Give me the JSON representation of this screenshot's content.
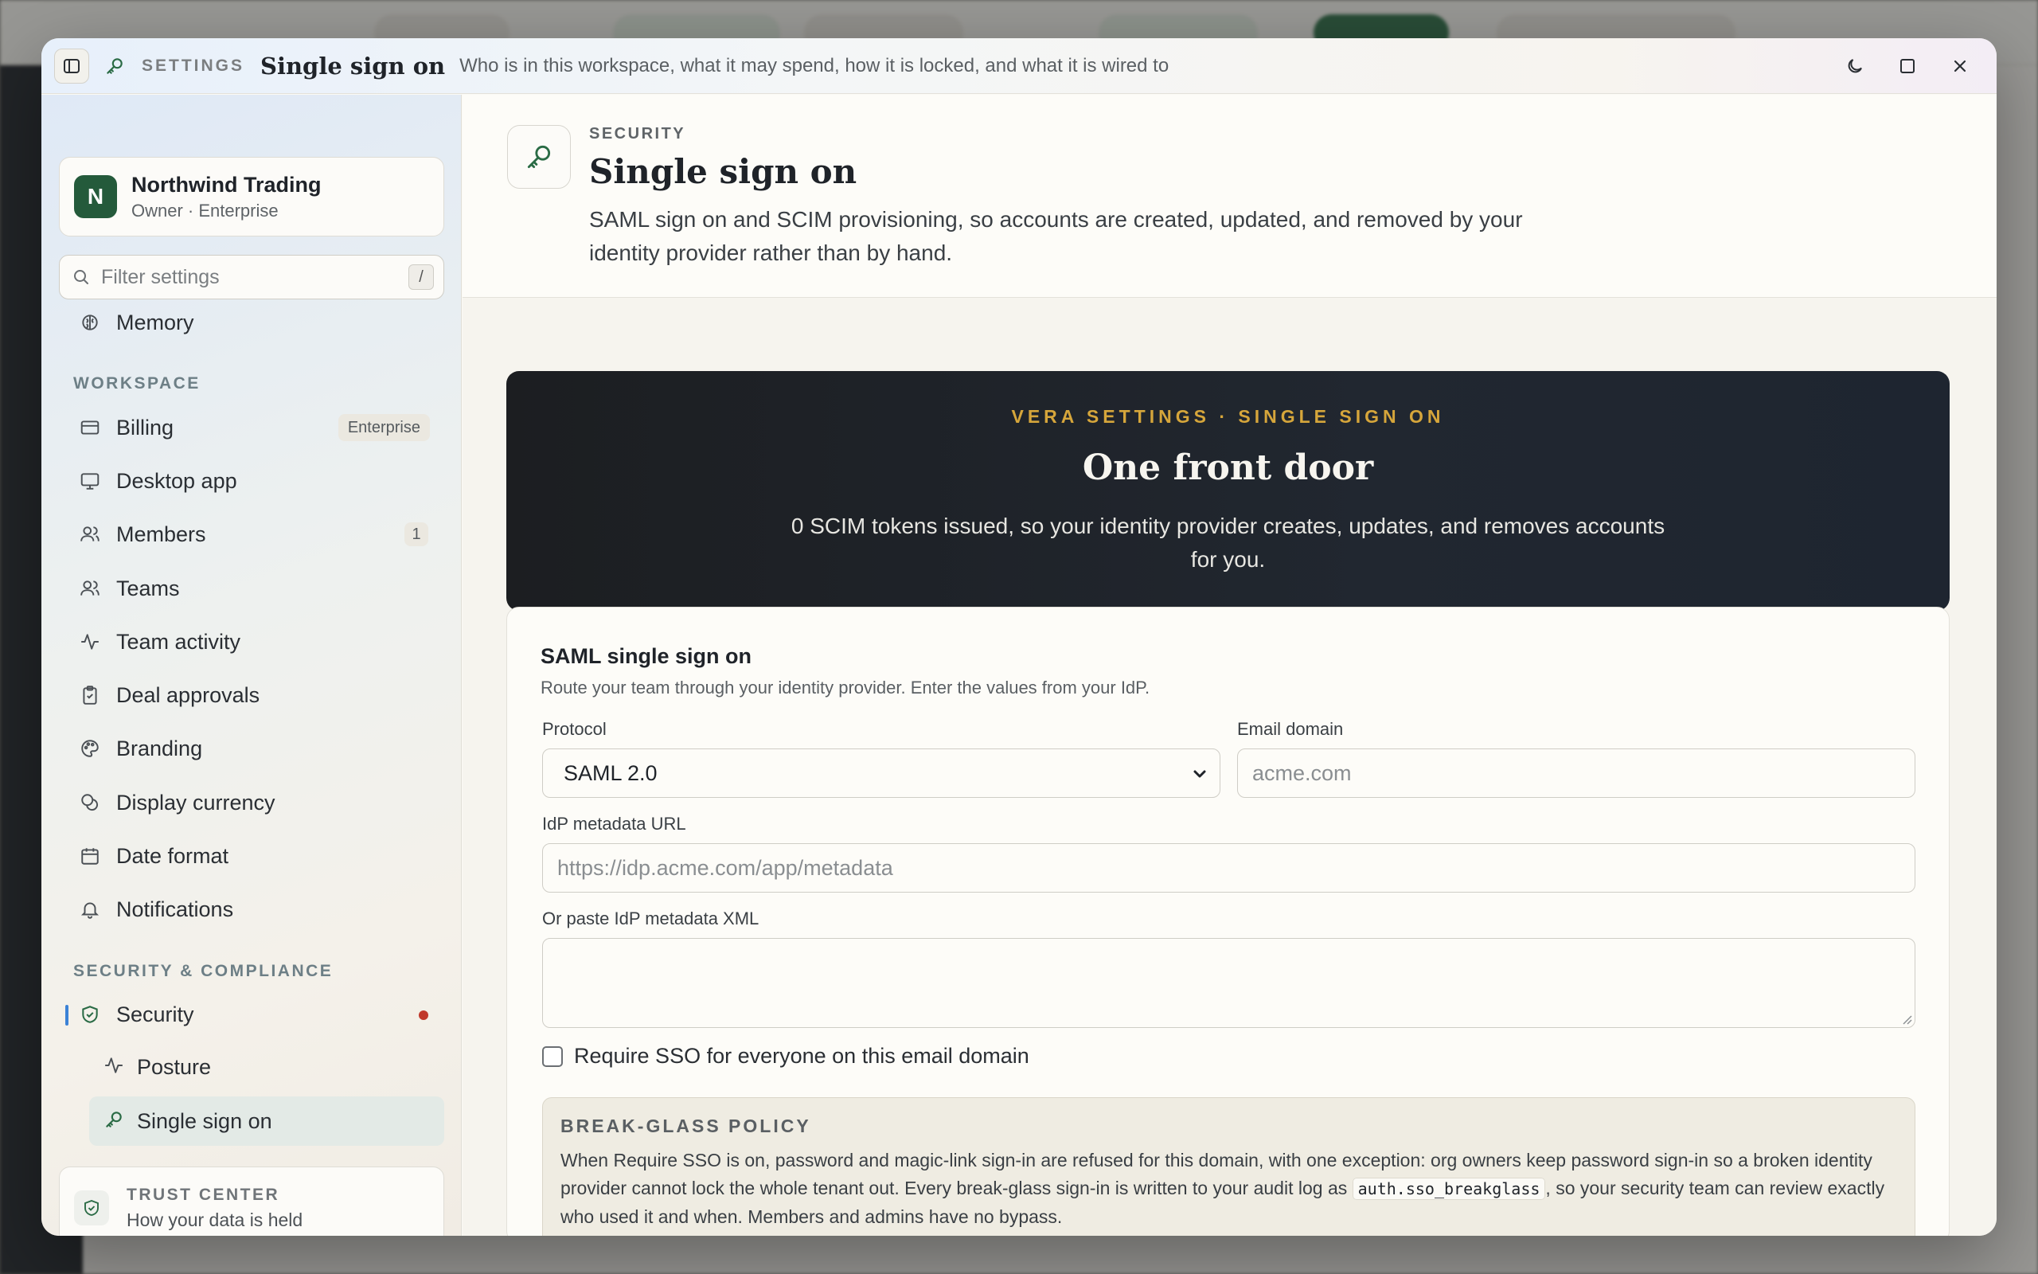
{
  "window": {
    "eyebrow": "SETTINGS",
    "title": "Single sign on",
    "subtitle": "Who is in this workspace, what it may spend, how it is locked, and what it is wired to"
  },
  "org": {
    "initial": "N",
    "name": "Northwind Trading",
    "role": "Owner · Enterprise"
  },
  "search": {
    "placeholder": "Filter settings",
    "shortcut": "/"
  },
  "sidebar": {
    "top_items": [
      {
        "label": "Memory",
        "icon": "brain-icon"
      }
    ],
    "workspace_heading": "WORKSPACE",
    "workspace_items": [
      {
        "label": "Billing",
        "icon": "credit-card-icon",
        "badge": "Enterprise"
      },
      {
        "label": "Desktop app",
        "icon": "monitor-icon"
      },
      {
        "label": "Members",
        "icon": "users-icon",
        "count": "1"
      },
      {
        "label": "Teams",
        "icon": "team-icon"
      },
      {
        "label": "Team activity",
        "icon": "activity-icon"
      },
      {
        "label": "Deal approvals",
        "icon": "clipboard-check-icon"
      },
      {
        "label": "Branding",
        "icon": "palette-icon"
      },
      {
        "label": "Display currency",
        "icon": "coins-icon"
      },
      {
        "label": "Date format",
        "icon": "calendar-icon"
      },
      {
        "label": "Notifications",
        "icon": "bell-icon"
      }
    ],
    "security_heading": "SECURITY & COMPLIANCE",
    "security_item": {
      "label": "Security",
      "icon": "shield-check-icon"
    },
    "security_sub_items": [
      {
        "label": "Posture",
        "icon": "activity-icon"
      },
      {
        "label": "Single sign on",
        "icon": "key-icon",
        "active": true
      }
    ],
    "trust": {
      "title": "TRUST CENTER",
      "subtitle": "How your data is held"
    }
  },
  "page": {
    "eyebrow": "SECURITY",
    "title": "Single sign on",
    "description": "SAML sign on and SCIM provisioning, so accounts are created, updated, and removed by your identity provider rather than by hand."
  },
  "hero": {
    "eyebrow": "VERA SETTINGS · SINGLE SIGN ON",
    "title": "One front door",
    "description": "0 SCIM tokens issued, so your identity provider creates, updates, and removes accounts for you."
  },
  "saml": {
    "title": "SAML single sign on",
    "subtitle": "Route your team through your identity provider. Enter the values from your IdP.",
    "protocol_label": "Protocol",
    "protocol_value": "SAML 2.0",
    "domain_label": "Email domain",
    "domain_placeholder": "acme.com",
    "metadata_url_label": "IdP metadata URL",
    "metadata_url_placeholder": "https://idp.acme.com/app/metadata",
    "metadata_xml_label": "Or paste IdP metadata XML",
    "require_sso_label": "Require SSO for everyone on this email domain",
    "require_sso_checked": false
  },
  "policy": {
    "title": "BREAK-GLASS POLICY",
    "text_before": "When Require SSO is on, password and magic-link sign-in are refused for this domain, with one exception: org owners keep password sign-in so a broken identity provider cannot lock the whole tenant out. Every break-glass sign-in is written to your audit log as ",
    "code": "auth.sso_breakglass",
    "text_after": ", so your security team can review exactly who used it and when. Members and admins have no bypass."
  },
  "colors": {
    "brand_green": "#245a3b",
    "hero_accent": "#d6a63b",
    "active_accent": "#3b82d6",
    "alert_dot": "#c0392b"
  }
}
